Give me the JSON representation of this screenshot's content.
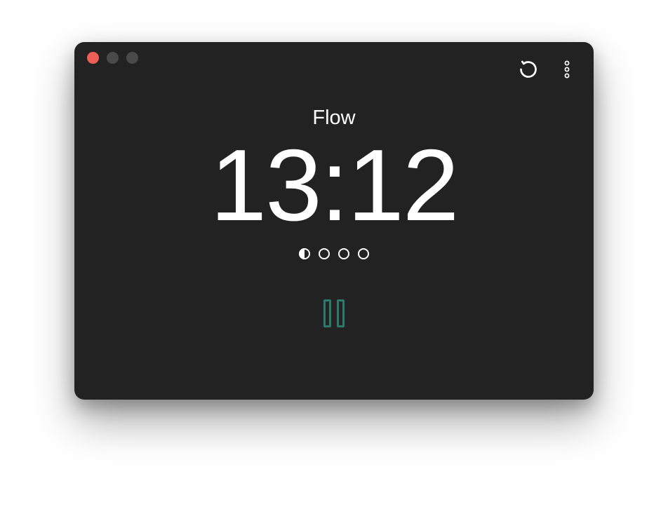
{
  "session": {
    "label": "Flow",
    "time": "13:12"
  },
  "progress": {
    "total": 4,
    "states": [
      "half",
      "empty",
      "empty",
      "empty"
    ]
  },
  "colors": {
    "background": "#222222",
    "text": "#ffffff",
    "accent": "#2b7a6b",
    "close": "#ec5f57",
    "inactive": "#4a4a4a"
  },
  "icons": {
    "reset": "reset-icon",
    "more": "more-icon",
    "pause": "pause-icon"
  }
}
